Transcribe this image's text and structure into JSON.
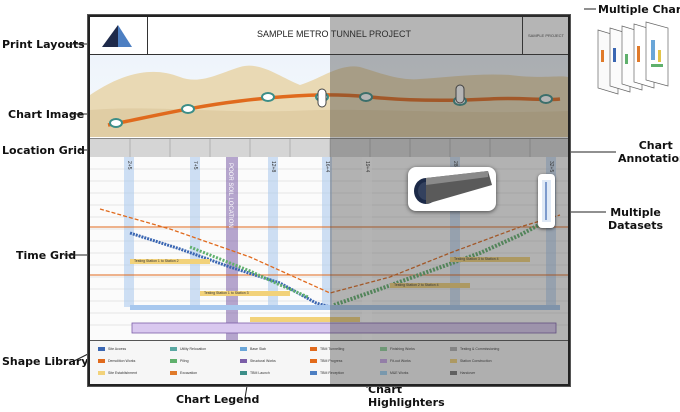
{
  "callouts": {
    "print_layouts": "Print Layouts",
    "chart_image": "Chart Image",
    "location_grid": "Location Grid",
    "time_grid": "Time Grid",
    "shape_library": "Shape Library",
    "chart_legend": "Chart Legend",
    "chart_highlighters": "Chart\nHighlighters",
    "multiple_charts": "Multiple Charts",
    "chart_annotations": "Chart\nAnnotations",
    "multiple_datasets": "Multiple\nDatasets"
  },
  "sheet": {
    "title": "SAMPLE METRO TUNNEL PROJECT",
    "corner_text": "SAMPLE PROJECT SOFTWARE"
  },
  "stations": [
    "2+5",
    "7+5",
    "12+8",
    "16+4",
    "19+4",
    "28+5",
    "32+5"
  ],
  "poor_soil_label": "POOR SOIL LOCATION",
  "testing_labels": [
    "Testing Station 1 to Station 2",
    "Testing Station 1 to Station 3",
    "Testing Station 2 to Station 4",
    "Testing Station 3 to Station 4"
  ],
  "legend_items": [
    "Site Access",
    "Demolition Works",
    "Site Establishment",
    "Utility Relocation",
    "Piling",
    "Excavation",
    "Base Slab",
    "Structural Works",
    "TBM Launch",
    "TBM Tunnelling",
    "TBM Progress",
    "TBM Reception",
    "Finishing Works",
    "Fit-out Works",
    "M&E Works",
    "Testing & Commissioning",
    "Station Construction",
    "Handover"
  ],
  "colors": {
    "accent": "#e36b1a",
    "track": "#e06a1d",
    "sand": "#e9d9b4",
    "teal_node": "#5aa8a2",
    "purple_band": "#7b5ea8",
    "green_series": "#5fb06c",
    "blue_series": "#3a66b2",
    "highlight_band": "#a8c8ee"
  },
  "icons": [
    "logo-icon",
    "drill-head-icon",
    "chart-stack-icon"
  ]
}
